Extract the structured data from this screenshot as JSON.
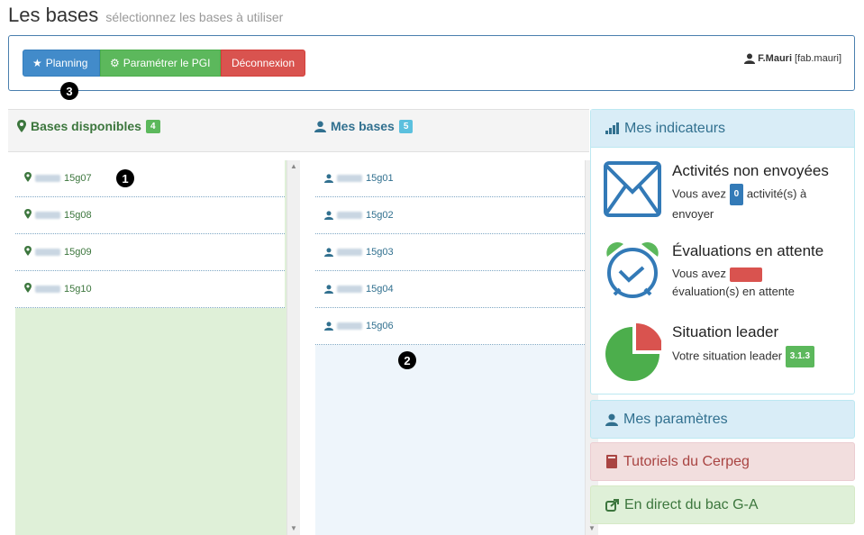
{
  "page": {
    "title": "Les bases",
    "subtitle": "sélectionnez les bases à utiliser"
  },
  "toolbar": {
    "planning_label": "Planning",
    "pgi_label": "Paramétrer le PGI",
    "logout_label": "Déconnexion",
    "user_name": "F.Mauri",
    "user_login": "[fab.mauri]"
  },
  "markers": {
    "m1": "1",
    "m2": "2",
    "m3": "3"
  },
  "available": {
    "title": "Bases disponibles",
    "count": "4",
    "items": [
      {
        "label": "15g07"
      },
      {
        "label": "15g08"
      },
      {
        "label": "15g09"
      },
      {
        "label": "15g10"
      }
    ]
  },
  "mine": {
    "title": "Mes bases",
    "count": "5",
    "items": [
      {
        "label": "15g01"
      },
      {
        "label": "15g02"
      },
      {
        "label": "15g03"
      },
      {
        "label": "15g04"
      },
      {
        "label": "15g06"
      }
    ]
  },
  "indicators": {
    "title": "Mes indicateurs",
    "activities": {
      "title": "Activités non envoyées",
      "text_before": "Vous avez",
      "count": "0",
      "text_after": "activité(s) à envoyer"
    },
    "evaluations": {
      "title": "Évaluations en attente",
      "text_before": "Vous avez",
      "text_after": "évaluation(s) en attente"
    },
    "leader": {
      "title": "Situation leader",
      "text": "Votre situation leader",
      "value": "3.1.3"
    }
  },
  "panels": {
    "params": "Mes paramètres",
    "tutorials": "Tutoriels du Cerpeg",
    "live": "En direct du bac G-A"
  },
  "colors": {
    "primary": "#428bca",
    "success": "#5cb85c",
    "danger": "#d9534f",
    "info": "#31708f"
  }
}
